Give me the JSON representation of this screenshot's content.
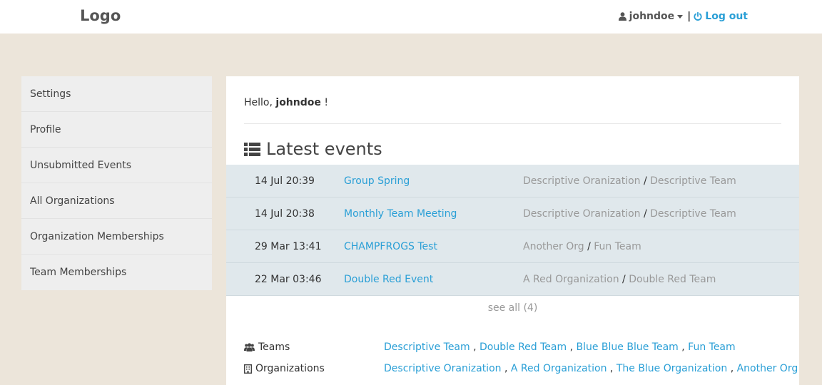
{
  "header": {
    "logo": "Logo",
    "username": "johndoe",
    "separator": "|",
    "logout_label": "Log out"
  },
  "sidebar": {
    "items": [
      {
        "label": "Settings"
      },
      {
        "label": "Profile"
      },
      {
        "label": "Unsubmitted Events"
      },
      {
        "label": "All Organizations"
      },
      {
        "label": "Organization Memberships"
      },
      {
        "label": "Team Memberships"
      }
    ]
  },
  "main": {
    "greeting_prefix": "Hello,",
    "greeting_name": "johndoe",
    "greeting_suffix": "!",
    "latest_title": "Latest events",
    "events": [
      {
        "date": "14 Jul 20:39",
        "name": "Group Spring",
        "organization": "Descriptive Oranization",
        "team": "Descriptive Team"
      },
      {
        "date": "14 Jul 20:38",
        "name": "Monthly Team Meeting",
        "organization": "Descriptive Oranization",
        "team": "Descriptive Team"
      },
      {
        "date": "29 Mar 13:41",
        "name": "CHAMPFROGS Test",
        "organization": "Another Org",
        "team": "Fun Team"
      },
      {
        "date": "22 Mar 03:46",
        "name": "Double Red Event",
        "organization": "A Red Organization",
        "team": "Double Red Team"
      }
    ],
    "see_all": "see all (4)",
    "teams_label": "Teams",
    "teams": [
      "Descriptive Team",
      "Double Red Team",
      "Blue Blue Blue Team",
      "Fun Team"
    ],
    "organizations_label": "Organizations",
    "organizations": [
      "Descriptive Oranization",
      "A Red Organization",
      "The Blue Organization",
      "Another Org"
    ]
  },
  "icons": {
    "user": "user-icon",
    "logout": "power-icon",
    "list": "list-icon",
    "teams": "users-icon",
    "organizations": "building-icon"
  },
  "colors": {
    "background": "#ece5da",
    "link": "#2a9fd6",
    "event_row": "#e0e8ec",
    "sidebar": "#eeeeee"
  }
}
